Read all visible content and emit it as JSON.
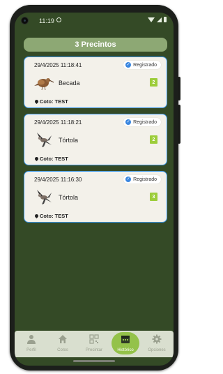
{
  "status_bar": {
    "time": "11:19"
  },
  "header": {
    "title": "3 Precintos"
  },
  "records": [
    {
      "datetime": "29/4/2025 11:18:41",
      "status": "Registrado",
      "species": "Becada",
      "species_icon": "woodcock-icon",
      "count": "2",
      "coto": "Coto: TEST"
    },
    {
      "datetime": "29/4/2025 11:18:21",
      "status": "Registrado",
      "species": "Tórtola",
      "species_icon": "turtle-dove-icon",
      "count": "2",
      "coto": "Coto: TEST"
    },
    {
      "datetime": "29/4/2025 11:16:30",
      "status": "Registrado",
      "species": "Tórtola",
      "species_icon": "turtle-dove-icon",
      "count": "3",
      "coto": "Coto: TEST"
    }
  ],
  "nav": [
    {
      "label": "Perfil",
      "icon": "person-icon",
      "active": false
    },
    {
      "label": "Cotos",
      "icon": "home-icon",
      "active": false
    },
    {
      "label": "Precintar",
      "icon": "qr-code-icon",
      "active": false
    },
    {
      "label": "Histórico",
      "icon": "calendar-icon",
      "active": true
    },
    {
      "label": "Opciones",
      "icon": "gear-icon",
      "active": false
    }
  ],
  "colors": {
    "background": "#344a26",
    "header": "#8da874",
    "card_border": "#3a96e8",
    "count_badge": "#9ccd3a",
    "nav_active": "#94c24a"
  }
}
